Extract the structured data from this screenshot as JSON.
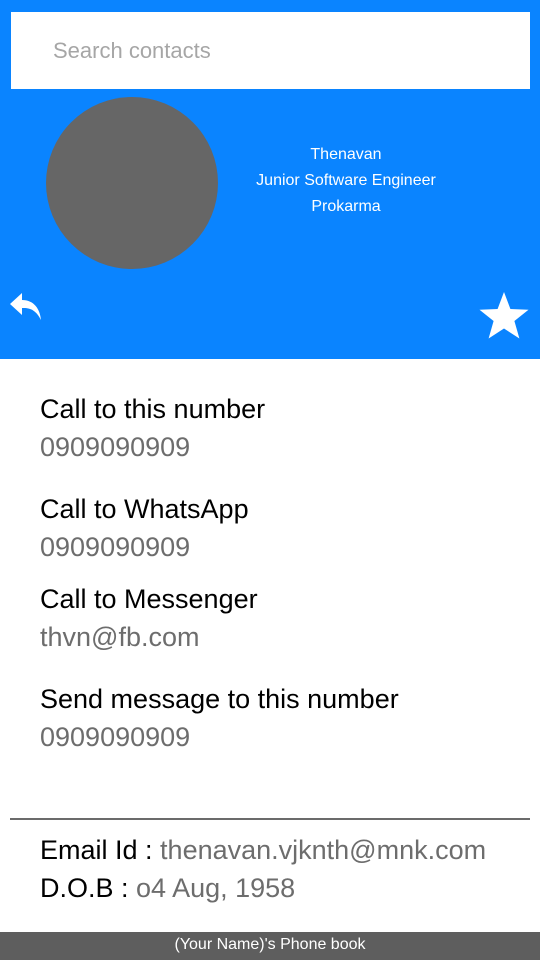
{
  "search": {
    "placeholder": "Search contacts"
  },
  "profile": {
    "name": "Thenavan",
    "title": "Junior Software Engineer",
    "company": "Prokarma"
  },
  "icons": {
    "back": "reply-arrow-icon",
    "favorite": "star-icon"
  },
  "colors": {
    "header": "#0a84ff",
    "avatar": "#666666",
    "muted_text": "#6d6d6d",
    "footer": "#5e5e5e"
  },
  "actions": [
    {
      "label": "Call to this number",
      "value": "0909090909"
    },
    {
      "label": "Call to WhatsApp",
      "value": "0909090909"
    },
    {
      "label": "Call to Messenger",
      "value": "thvn@fb.com"
    },
    {
      "label": "Send message to this number",
      "value": "0909090909"
    }
  ],
  "details": {
    "email_label": "Email Id : ",
    "email_value": "thenavan.vjknth@mnk.com",
    "dob_label": "D.O.B : ",
    "dob_value": "o4 Aug, 1958"
  },
  "footer": {
    "text": "(Your Name)'s Phone book"
  }
}
